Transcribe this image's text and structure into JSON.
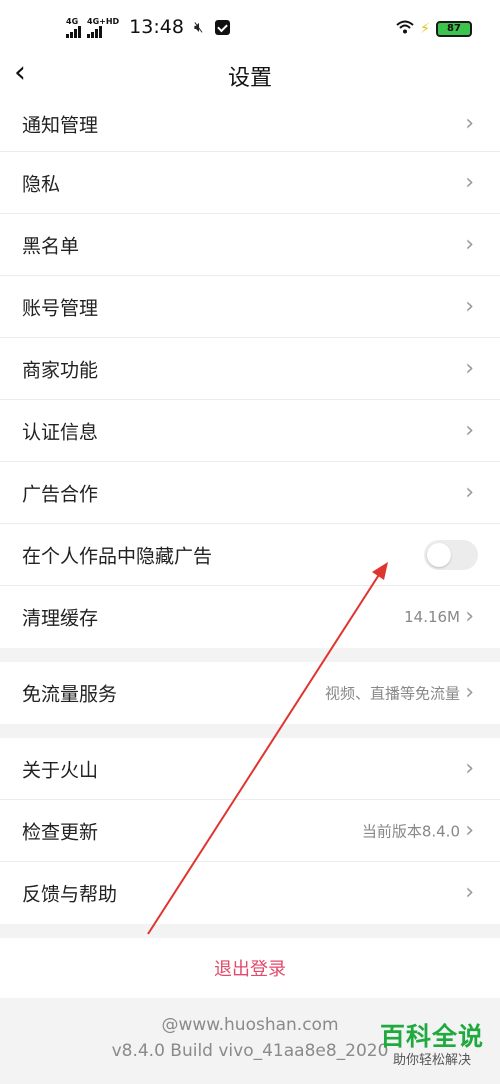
{
  "status_bar": {
    "net1": "4G",
    "net2": "4G+HD",
    "time": "13:48",
    "battery": "87",
    "icons": [
      "signal-icon",
      "mute-icon",
      "message-icon",
      "wifi-icon",
      "charging-icon",
      "battery-icon"
    ]
  },
  "nav": {
    "title": "设置",
    "back_glyph": "‹"
  },
  "rows": {
    "notification": "通知管理",
    "privacy": "隐私",
    "blacklist": "黑名单",
    "account": "账号管理",
    "merchant": "商家功能",
    "verification": "认证信息",
    "ads": "广告合作",
    "hide_ads": "在个人作品中隐藏广告",
    "clear_cache": "清理缓存",
    "cache_size": "14.16M",
    "free_data": "免流量服务",
    "free_data_desc": "视频、直播等免流量",
    "about": "关于火山",
    "check_update": "检查更新",
    "current_version": "当前版本8.4.0",
    "feedback": "反馈与帮助",
    "chevron": "›"
  },
  "toggles": {
    "hide_ads_on": false
  },
  "logout": "退出登录",
  "footer": {
    "site": "@www.huoshan.com",
    "build": "v8.4.0 Build vivo_41aa8e8_2020"
  },
  "watermark": {
    "title": "百科全说",
    "subtitle": "助你轻松解决"
  },
  "colors": {
    "logout": "#e24a6b",
    "watermark": "#1faa3f",
    "annotation_arrow": "#e0342e"
  }
}
